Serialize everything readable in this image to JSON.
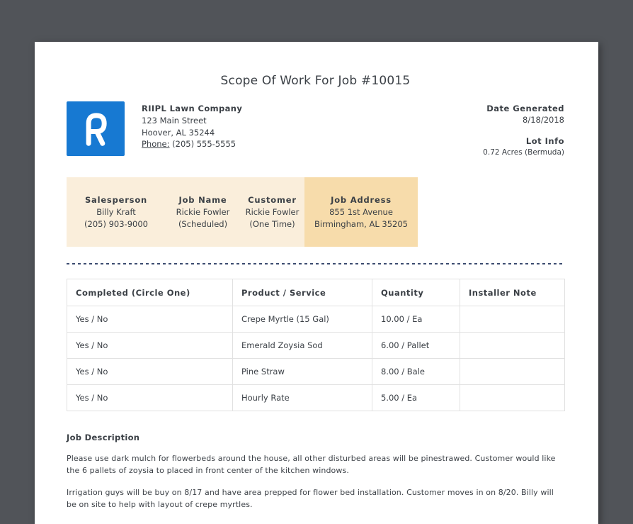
{
  "title": "Scope Of Work For Job #10015",
  "company": {
    "name": "RIIPL Lawn Company",
    "address_line1": "123 Main Street",
    "address_line2": "Hoover, AL 35244",
    "phone_label": "Phone:",
    "phone_value": " (205) 555-5555"
  },
  "meta": {
    "date_generated_label": "Date Generated",
    "date_generated": "8/18/2018",
    "lot_info_label": "Lot Info",
    "lot_info": "0.72 Acres (Bermuda)"
  },
  "job_info": [
    {
      "label": "Salesperson",
      "line1": "Billy Kraft",
      "line2": "(205) 903-9000"
    },
    {
      "label": "Job Name",
      "line1": "Rickie Fowler",
      "line2": "(Scheduled)"
    },
    {
      "label": "Customer",
      "line1": "Rickie Fowler",
      "line2": "(One Time)"
    },
    {
      "label": "Job Address",
      "line1": "855 1st Avenue",
      "line2": "Birmingham, AL 35205"
    }
  ],
  "table": {
    "headers": [
      "Completed (Circle One)",
      "Product / Service",
      "Quantity",
      "Installer Note"
    ],
    "rows": [
      [
        "Yes / No",
        "Crepe Myrtle (15 Gal)",
        "10.00 / Ea",
        ""
      ],
      [
        "Yes / No",
        "Emerald Zoysia Sod",
        "6.00 / Pallet",
        ""
      ],
      [
        "Yes / No",
        "Pine Straw",
        "8.00 / Bale",
        ""
      ],
      [
        "Yes / No",
        "Hourly Rate",
        "5.00 / Ea",
        ""
      ]
    ]
  },
  "job_description": {
    "heading": "Job Description",
    "paragraphs": [
      "Please use dark mulch for flowerbeds around the house, all other disturbed areas will be pinestrawed. Customer would like the 6 pallets of zoysia to placed in front center of the kitchen windows.",
      "Irrigation guys will be buy on 8/17 and have area prepped for flower bed installation. Customer moves in on 8/20. Billy will be on site to help with layout of crepe myrtles."
    ]
  },
  "colors": {
    "canvas_bg": "#515459",
    "page_bg": "#ffffff",
    "text": "#3a3f45",
    "logo_blue": "#1779d2",
    "band_light": "#faeedb",
    "band_highlight": "#f7dcab",
    "table_border": "#e1e1e1",
    "divider_dash": "#3c4c70"
  }
}
